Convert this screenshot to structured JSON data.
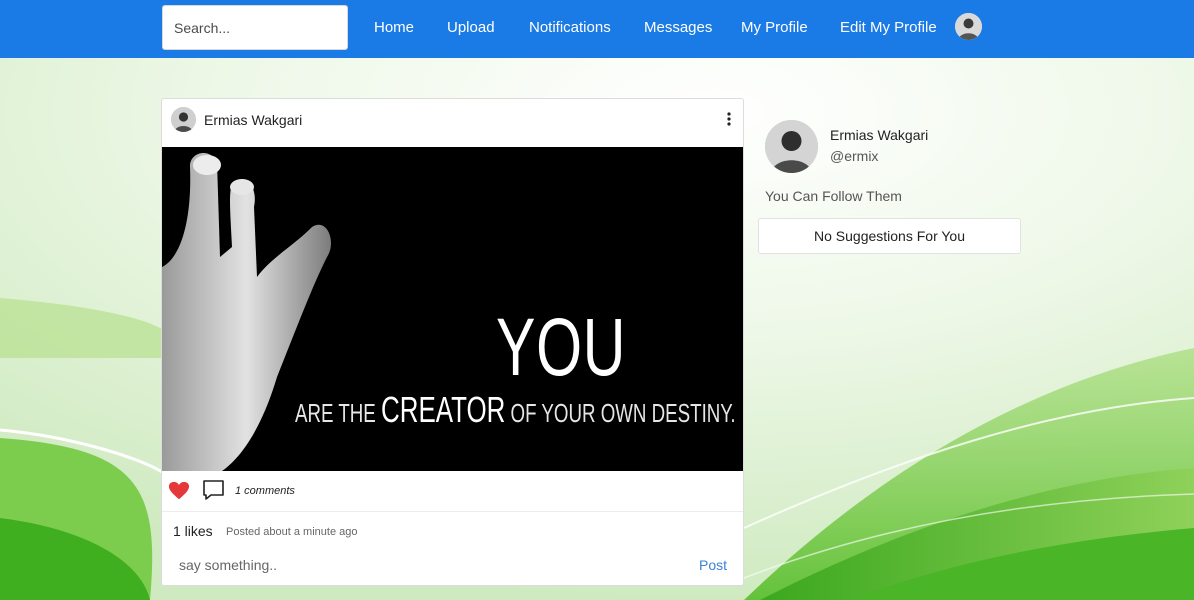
{
  "nav": {
    "search_placeholder": "Search...",
    "links": [
      "Home",
      "Upload",
      "Notifications",
      "Messages",
      "My Profile",
      "Edit My Profile"
    ],
    "avatar_icon": "user-avatar"
  },
  "post": {
    "author": "Ermias Wakgari",
    "menu_icon": "vertical-dots-icon",
    "image": {
      "text_big": "YOU",
      "text_line_1": "ARE THE",
      "text_line_2": "CREATOR",
      "text_line_3": "OF YOUR OWN DESTINY."
    },
    "like_icon": "heart-icon",
    "comment_icon": "comment-icon",
    "comments_count": "1 comments",
    "likes": "1 likes",
    "posted": "Posted about a minute ago",
    "comment_placeholder": "say something..",
    "post_label": "Post"
  },
  "sidebar": {
    "name": "Ermias Wakgari",
    "handle": "@ermix",
    "follow_heading": "You Can Follow Them",
    "suggestions_empty": "No Suggestions For You"
  },
  "colors": {
    "navbar": "#1a7ae6",
    "heart": "#e5383b",
    "post_link": "#3b82d6"
  }
}
